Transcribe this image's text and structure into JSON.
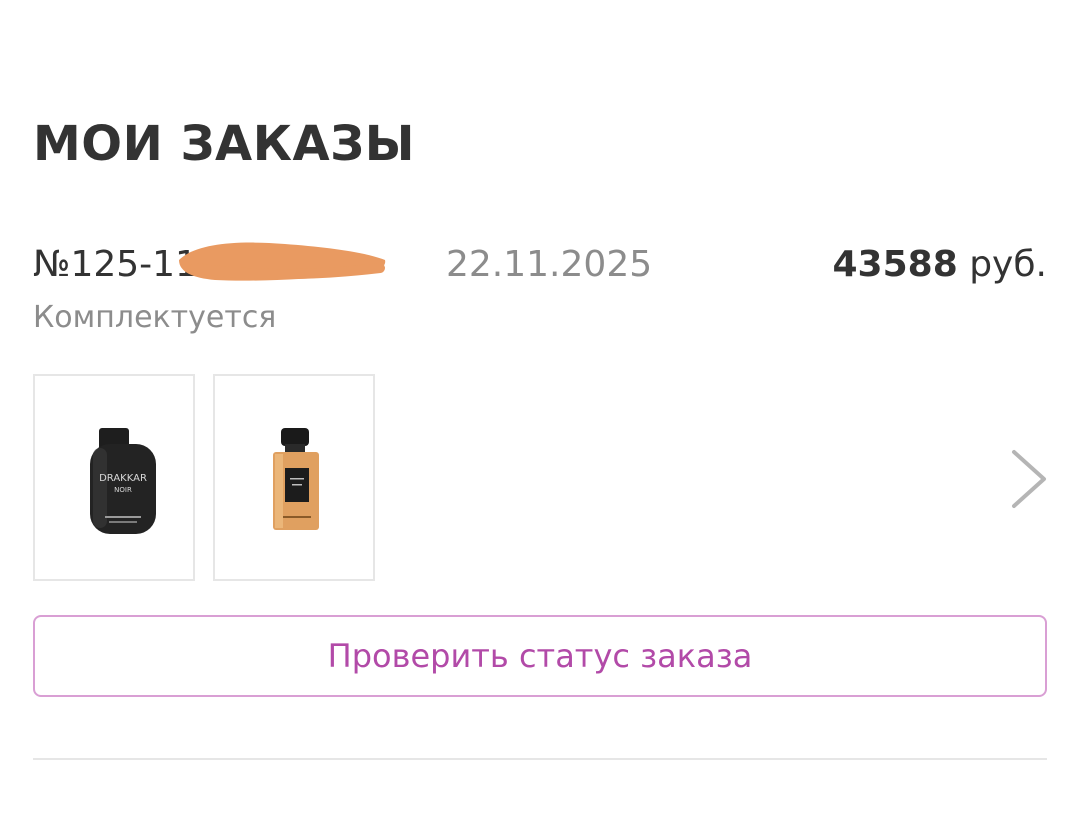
{
  "page": {
    "title": "МОИ ЗАКАЗЫ"
  },
  "order": {
    "number": "№125-11",
    "date": "22.11.2025",
    "price_amount": "43588",
    "price_currency": " руб.",
    "status": "Комплектуется",
    "products": [
      {
        "brand_text": "DRAKKAR",
        "sub_text": "NOIR"
      },
      {
        "brand_text": "",
        "sub_text": ""
      }
    ],
    "check_status_label": "Проверить статус заказа"
  },
  "colors": {
    "accent": "#b24aa8",
    "button_border": "#d99fd4",
    "redaction": "#e99a61",
    "text_primary": "#333333",
    "text_secondary": "#8c8c8c"
  },
  "icons": {
    "next": "chevron-right-icon"
  }
}
